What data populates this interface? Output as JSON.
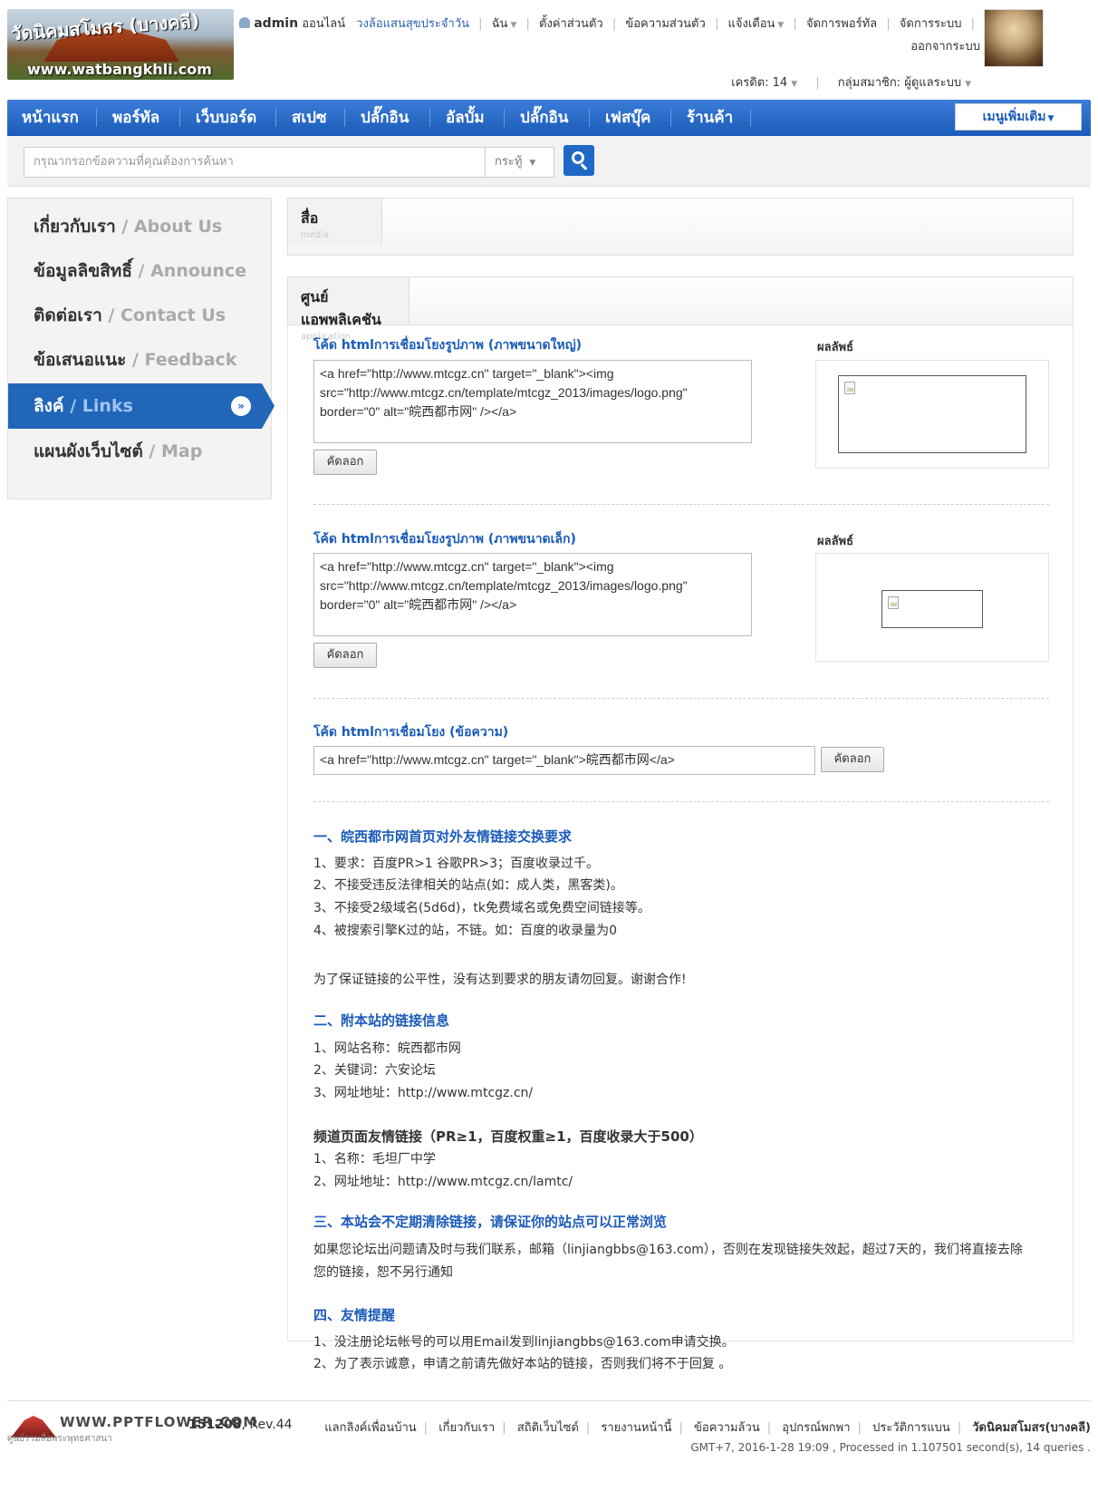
{
  "header": {
    "logo_text_thai": "วัดนิคมสโมสร (บางคลี)",
    "logo_url": "www.watbangkhli.com",
    "user": {
      "username": "admin",
      "status": "ออนไลน์",
      "daily_wheel": "วงล้อแสนสุขประจำวัน",
      "me": "ฉัน",
      "settings": "ตั้งค่าส่วนตัว",
      "messages": "ข้อความส่วนตัว",
      "notifications": "แจ้งเตือน",
      "portal_manage": "จัดการพอร์ทัล",
      "system_manage": "จัดการระบบ",
      "logout": "ออกจากระบบ"
    },
    "credit_label": "เครดิต: 14",
    "group_label": "กลุ่มสมาชิก: ผู้ดูแลระบบ"
  },
  "mainnav": {
    "items": [
      "หน้าแรก",
      "พอร์ทัล",
      "เว็บบอร์ด",
      "สเปซ",
      "ปลั๊กอิน",
      "อัลบั้ม",
      "ปลั๊กอิน",
      "เฟสบุ๊ค",
      "ร้านค้า"
    ],
    "more_menu": "เมนูเพิ่มเติม"
  },
  "search": {
    "placeholder": "กรุณากรอกข้อความที่คุณต้องการค้นหา",
    "type": "กระทู้"
  },
  "sidebar": {
    "items": [
      {
        "th": "เกี่ยวกับเรา",
        "en": " / About Us"
      },
      {
        "th": "ข้อมูลลิขสิทธิ์",
        "en": " / Announce"
      },
      {
        "th": "ติดต่อเรา",
        "en": " / Contact Us"
      },
      {
        "th": "ข้อเสนอแนะ",
        "en": " / Feedback"
      },
      {
        "th": "ลิงค์",
        "en": " / Links"
      },
      {
        "th": "แผนผังเว็บไซต์",
        "en": " / Map"
      }
    ]
  },
  "panels": {
    "media": {
      "title": "สื่อ",
      "subtitle": "media"
    },
    "app": {
      "title": "ศูนย์แอพพลิเคชัน",
      "subtitle": "application"
    }
  },
  "linkcodes": {
    "large_title": "โค้ด htmlการเชื่อมโยงรูปภาพ (ภาพขนาดใหญ่)",
    "small_title": "โค้ด htmlการเชื่อมโยงรูปภาพ (ภาพขนาดเล็ก)",
    "text_title": "โค้ด htmlการเชื่อมโยง (ข้อความ)",
    "result_label": "ผลลัพธ์",
    "copy_label": "คัดลอก",
    "code_line1": "<a href=\"http://www.mtcgz.cn\" target=\"_blank\"><img",
    "code_line2": "src=\"http://www.mtcgz.cn/template/mtcgz_2013/images/logo.png\"",
    "code_line3": "border=\"0\" alt=\"皖西都市网\" /></a>",
    "text_code": "<a href=\"http://www.mtcgz.cn\" target=\"_blank\">皖西都市网</a>"
  },
  "rules": {
    "sec1_title": "一、皖西都市网首页对外友情链接交换要求",
    "sec1_lines": [
      "1、要求：百度PR>1 谷歌PR>3；百度收录过千。",
      "2、不接受违反法律相关的站点(如：成人类，黑客类)。",
      "3、不接受2级域名(5d6d)，tk免费域名或免费空间链接等。",
      "4、被搜索引擎K过的站，不链。如：百度的收录量为0"
    ],
    "fairness_note": "为了保证链接的公平性，没有达到要求的朋友请勿回复。谢谢合作!",
    "sec2_title": "二、附本站的链接信息",
    "sec2_lines": [
      "1、网站名称：皖西都市网",
      "2、关键词：六安论坛",
      "3、网址地址：http://www.mtcgz.cn/"
    ],
    "channel_title": "频道页面友情链接（PR≥1，百度权重≥1，百度收录大于500）",
    "channel_lines": [
      "1、名称：毛坦厂中学",
      "2、网址地址：http://www.mtcgz.cn/lamtc/"
    ],
    "sec3_title": "三、本站会不定期清除链接，请保证你的站点可以正常浏览",
    "sec3_lines": [
      "如果您论坛出问题请及时与我们联系，邮箱（linjiangbbs@163.com），否则在发现链接失效起，超过7天的，我们将直接去除",
      "您的链接，恕不另行通知"
    ],
    "sec4_title": "四、友情提醒",
    "sec4_lines": [
      "1、没注册论坛帐号的可以用Email发到linjiangbbs@163.com申请交换。",
      "2、为了表示诚意，申请之前请先做好本站的链接，否则我们将不于回复 。"
    ]
  },
  "footer": {
    "brand": "WWW.PPTFLOWER.COM",
    "slogan": "ศูนย์รวมสื่อพระพุทธศาสนา",
    "build_prefix": "151208",
    "build_rev": ", Rev.44",
    "links": [
      "แลกลิงค์เพื่อนบ้าน",
      "เกี่ยวกับเรา",
      "สถิติเว็บไซต์",
      "รายงานหน้านี้",
      "ข้อความล้วน",
      "อุปกรณ์พกพา",
      "ประวัติการแบน"
    ],
    "site_name": "วัดนิคมสโมสร(บางคลี)",
    "meta": "GMT+7, 2016-1-28 19:09 , Processed in 1.107501 second(s), 14 queries ."
  }
}
